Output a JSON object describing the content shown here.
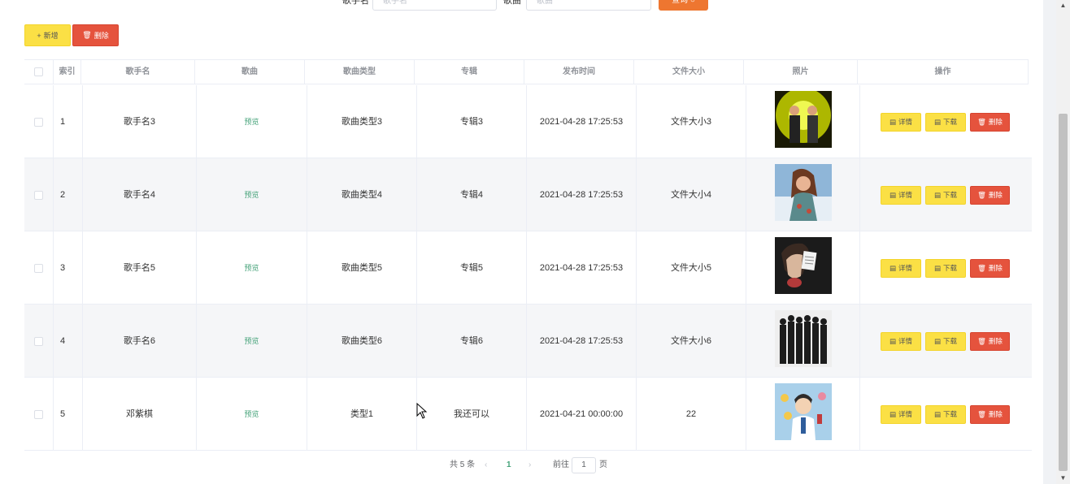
{
  "search": {
    "singer_label": "歌手名",
    "singer_placeholder": "歌手名",
    "song_label": "歌曲",
    "song_placeholder": "歌曲",
    "query_label": "查询 ○"
  },
  "toolbar": {
    "add_label": "新增",
    "delete_label": "删除"
  },
  "table": {
    "headers": {
      "index": "索引",
      "singer": "歌手名",
      "song": "歌曲",
      "song_type": "歌曲类型",
      "album": "专辑",
      "release_time": "发布时间",
      "file_size": "文件大小",
      "photo": "照片",
      "actions": "操作"
    },
    "rows": [
      {
        "index": "1",
        "singer": "歌手名3",
        "song": "预览",
        "song_type": "歌曲类型3",
        "album": "专辑3",
        "release_time": "2021-04-28 17:25:53",
        "file_size": "文件大小3"
      },
      {
        "index": "2",
        "singer": "歌手名4",
        "song": "预览",
        "song_type": "歌曲类型4",
        "album": "专辑4",
        "release_time": "2021-04-28 17:25:53",
        "file_size": "文件大小4"
      },
      {
        "index": "3",
        "singer": "歌手名5",
        "song": "预览",
        "song_type": "歌曲类型5",
        "album": "专辑5",
        "release_time": "2021-04-28 17:25:53",
        "file_size": "文件大小5"
      },
      {
        "index": "4",
        "singer": "歌手名6",
        "song": "预览",
        "song_type": "歌曲类型6",
        "album": "专辑6",
        "release_time": "2021-04-28 17:25:53",
        "file_size": "文件大小6"
      },
      {
        "index": "5",
        "singer": "邓紫棋",
        "song": "预览",
        "song_type": "类型1",
        "album": "我还可以",
        "release_time": "2021-04-21 00:00:00",
        "file_size": "22"
      }
    ],
    "actions": {
      "detail": "详情",
      "download": "下载",
      "delete": "删除"
    }
  },
  "pagination": {
    "total": "共 5 条",
    "current_page": "1",
    "goto_label": "前往",
    "goto_value": "1",
    "page_suffix": "页"
  },
  "colors": {
    "accent_yellow": "#fbe045",
    "accent_red": "#e5533d",
    "query_orange": "#ee7630",
    "preview_green": "#46a37a"
  }
}
